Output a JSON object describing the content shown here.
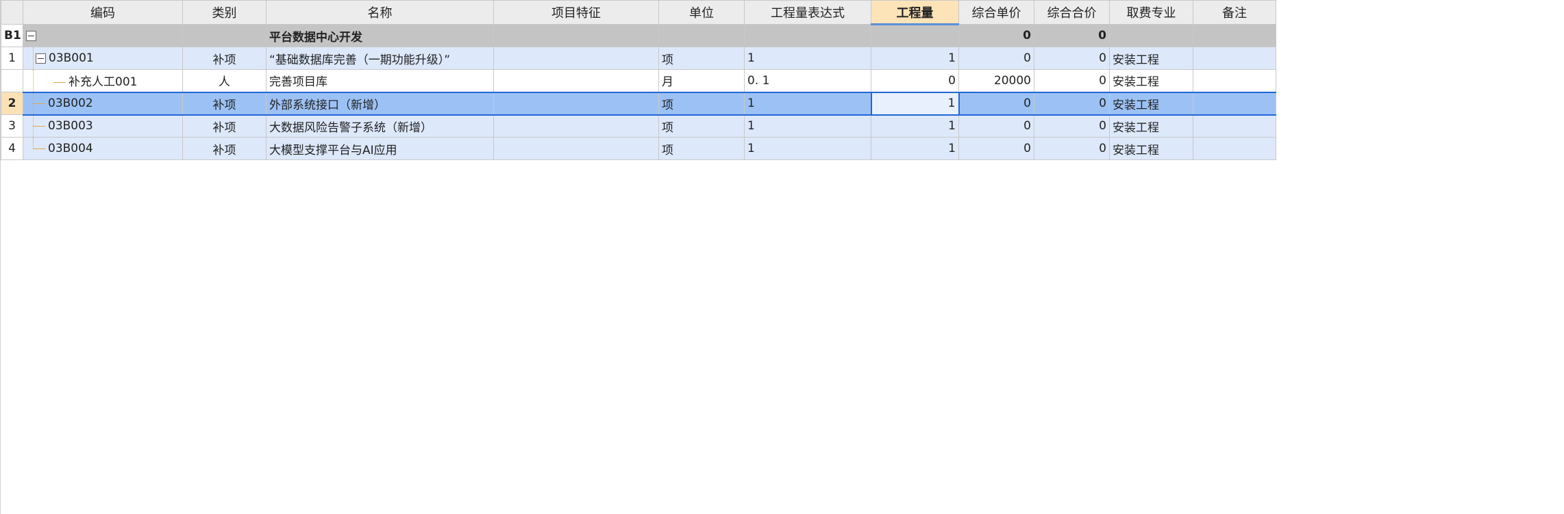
{
  "columns": [
    "编码",
    "类别",
    "名称",
    "项目特征",
    "单位",
    "工程量表达式",
    "工程量",
    "综合单价",
    "综合合价",
    "取费专业",
    "备注"
  ],
  "active_column": "工程量",
  "rows": [
    {
      "rownum": "B1",
      "code": "",
      "type": "",
      "name": "平台数据中心开发",
      "feature": "",
      "unit": "",
      "expr": "",
      "qty": "",
      "unit_price": "0",
      "total": "0",
      "fee": "",
      "note": ""
    },
    {
      "rownum": "1",
      "code": "03B001",
      "type": "补项",
      "name": "“基础数据库完善（一期功能升级）”",
      "feature": "",
      "unit": "项",
      "expr": "1",
      "qty": "1",
      "unit_price": "0",
      "total": "0",
      "fee": "安装工程",
      "note": ""
    },
    {
      "rownum": "",
      "code": "补充人工001",
      "type": "人",
      "name": "完善项目库",
      "feature": "",
      "unit": "月",
      "expr": "0. 1",
      "qty": "0",
      "unit_price": "20000",
      "total": "0",
      "fee": "安装工程",
      "note": ""
    },
    {
      "rownum": "2",
      "code": "03B002",
      "type": "补项",
      "name": "外部系统接口（新增）",
      "feature": "",
      "unit": "项",
      "expr": "1",
      "qty": "1",
      "unit_price": "0",
      "total": "0",
      "fee": "安装工程",
      "note": ""
    },
    {
      "rownum": "3",
      "code": "03B003",
      "type": "补项",
      "name": "大数据风险告警子系统（新增）",
      "feature": "",
      "unit": "项",
      "expr": "1",
      "qty": "1",
      "unit_price": "0",
      "total": "0",
      "fee": "安装工程",
      "note": ""
    },
    {
      "rownum": "4",
      "code": "03B004",
      "type": "补项",
      "name": "大模型支撑平台与AI应用",
      "feature": "",
      "unit": "项",
      "expr": "1",
      "qty": "1",
      "unit_price": "0",
      "total": "0",
      "fee": "安装工程",
      "note": ""
    }
  ]
}
